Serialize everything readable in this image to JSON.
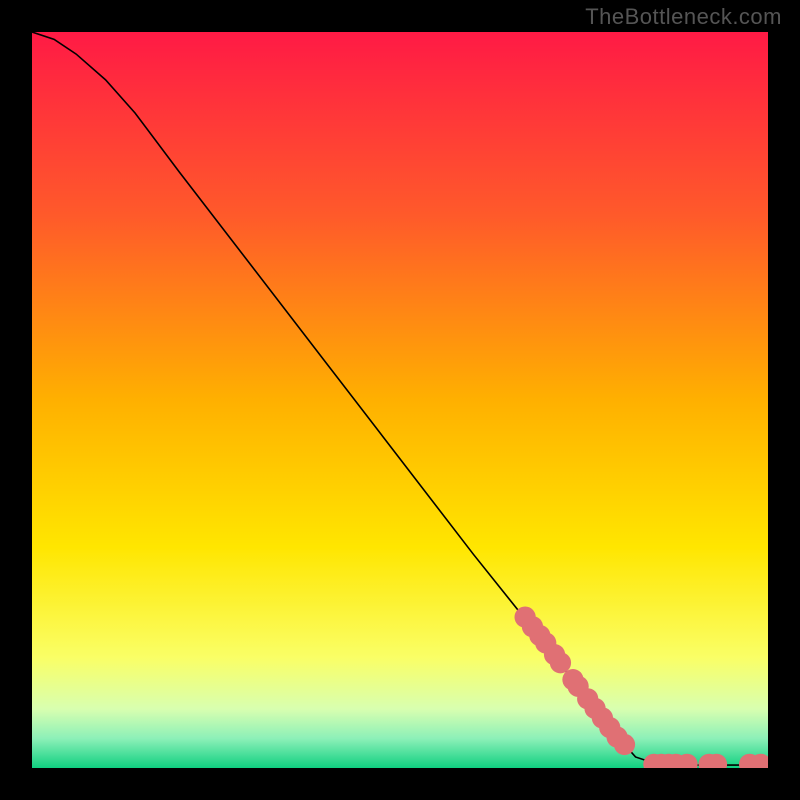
{
  "watermark": "TheBottleneck.com",
  "colors": {
    "frame_bg": "#000000",
    "curve_stroke": "#000000",
    "marker_fill": "#e07074",
    "marker_stroke": "#a84a4e"
  },
  "chart_data": {
    "type": "line",
    "title": "",
    "xlabel": "",
    "ylabel": "",
    "xlim": [
      0,
      100
    ],
    "ylim": [
      0,
      100
    ],
    "gradient_stops": [
      {
        "offset": 0.0,
        "color": "#ff1a45"
      },
      {
        "offset": 0.25,
        "color": "#ff5a2a"
      },
      {
        "offset": 0.5,
        "color": "#ffb000"
      },
      {
        "offset": 0.7,
        "color": "#ffe600"
      },
      {
        "offset": 0.85,
        "color": "#faff66"
      },
      {
        "offset": 0.92,
        "color": "#d8ffb0"
      },
      {
        "offset": 0.96,
        "color": "#8cf0b8"
      },
      {
        "offset": 1.0,
        "color": "#10d080"
      }
    ],
    "curve": [
      {
        "x": 0,
        "y": 100
      },
      {
        "x": 3,
        "y": 99
      },
      {
        "x": 6,
        "y": 97
      },
      {
        "x": 10,
        "y": 93.5
      },
      {
        "x": 14,
        "y": 89
      },
      {
        "x": 20,
        "y": 81
      },
      {
        "x": 30,
        "y": 68
      },
      {
        "x": 40,
        "y": 55
      },
      {
        "x": 50,
        "y": 42
      },
      {
        "x": 60,
        "y": 29
      },
      {
        "x": 70,
        "y": 16.5
      },
      {
        "x": 78,
        "y": 6
      },
      {
        "x": 82,
        "y": 1.5
      },
      {
        "x": 85,
        "y": 0.5
      },
      {
        "x": 90,
        "y": 0.4
      },
      {
        "x": 95,
        "y": 0.4
      },
      {
        "x": 100,
        "y": 0.4
      }
    ],
    "markers": [
      {
        "x": 67,
        "y": 20.5,
        "r": 1.0
      },
      {
        "x": 68,
        "y": 19.2,
        "r": 1.0
      },
      {
        "x": 69,
        "y": 18.0,
        "r": 1.0
      },
      {
        "x": 69.8,
        "y": 17.0,
        "r": 1.0
      },
      {
        "x": 71,
        "y": 15.4,
        "r": 1.0
      },
      {
        "x": 71.8,
        "y": 14.3,
        "r": 1.0
      },
      {
        "x": 73.5,
        "y": 12.0,
        "r": 1.0
      },
      {
        "x": 74.2,
        "y": 11.1,
        "r": 1.0
      },
      {
        "x": 75.5,
        "y": 9.4,
        "r": 1.0
      },
      {
        "x": 76.5,
        "y": 8.1,
        "r": 1.0
      },
      {
        "x": 77.5,
        "y": 6.8,
        "r": 1.0
      },
      {
        "x": 78.5,
        "y": 5.5,
        "r": 1.0
      },
      {
        "x": 79.5,
        "y": 4.2,
        "r": 1.0
      },
      {
        "x": 80.5,
        "y": 3.2,
        "r": 1.0
      },
      {
        "x": 84.5,
        "y": 0.5,
        "r": 1.0
      },
      {
        "x": 85.5,
        "y": 0.5,
        "r": 1.0
      },
      {
        "x": 86.5,
        "y": 0.5,
        "r": 1.0
      },
      {
        "x": 87.5,
        "y": 0.5,
        "r": 1.0
      },
      {
        "x": 89.0,
        "y": 0.5,
        "r": 1.0
      },
      {
        "x": 92.0,
        "y": 0.5,
        "r": 1.0
      },
      {
        "x": 93.0,
        "y": 0.5,
        "r": 1.0
      },
      {
        "x": 97.5,
        "y": 0.5,
        "r": 1.0
      },
      {
        "x": 99.0,
        "y": 0.5,
        "r": 1.0
      }
    ]
  }
}
